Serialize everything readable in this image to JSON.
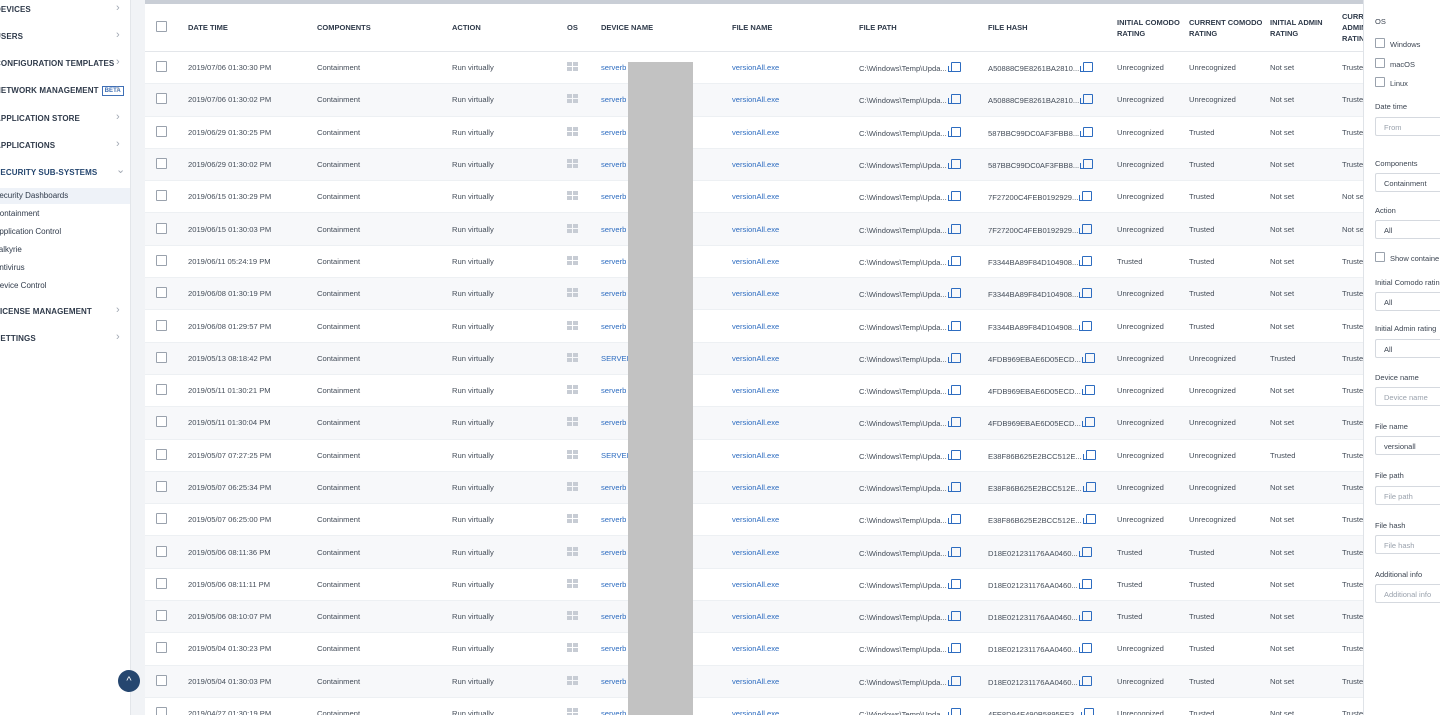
{
  "sidebar": {
    "items": [
      {
        "label": "DEVICES",
        "chevron": "›"
      },
      {
        "label": "USERS",
        "chevron": "›"
      },
      {
        "label": "CONFIGURATION TEMPLATES",
        "chevron": "›"
      },
      {
        "label": "NETWORK MANAGEMENT",
        "badge": "BETA",
        "chevron": "›"
      },
      {
        "label": "APPLICATION STORE",
        "chevron": "›"
      },
      {
        "label": "APPLICATIONS",
        "chevron": "›"
      },
      {
        "label": "SECURITY SUB-SYSTEMS",
        "chevron": "⌄"
      }
    ],
    "subitems": [
      "Security Dashboards",
      "Containment",
      "Application Control",
      "Valkyrie",
      "Antivirus",
      "Device Control"
    ],
    "bottom_items": [
      {
        "label": "LICENSE MANAGEMENT",
        "chevron": "›"
      },
      {
        "label": "SETTINGS",
        "chevron": "›"
      }
    ],
    "scroll_top_icon": "^"
  },
  "table": {
    "columns": [
      "DATE TIME",
      "COMPONENTS",
      "ACTION",
      "OS",
      "DEVICE NAME",
      "FILE NAME",
      "FILE PATH",
      "FILE HASH",
      "INITIAL COMODO RATING",
      "CURRENT COMODO RATING",
      "INITIAL ADMIN RATING",
      "CURRENT ADMIN RATING"
    ],
    "rows": [
      {
        "date": "2019/07/06 01:30:30 PM",
        "component": "Containment",
        "action": "Run virtually",
        "device": "serverb",
        "file": "versionAll.exe",
        "path": "C:\\Windows\\Temp\\Upda...",
        "hash": "A50888C9E8261BA2810...",
        "icr": "Unrecognized",
        "ccr": "Unrecognized",
        "iar": "Not set",
        "car": "Truste"
      },
      {
        "date": "2019/07/06 01:30:02 PM",
        "component": "Containment",
        "action": "Run virtually",
        "device": "serverb",
        "file": "versionAll.exe",
        "path": "C:\\Windows\\Temp\\Upda...",
        "hash": "A50888C9E8261BA2810...",
        "icr": "Unrecognized",
        "ccr": "Unrecognized",
        "iar": "Not set",
        "car": "Truste"
      },
      {
        "date": "2019/06/29 01:30:25 PM",
        "component": "Containment",
        "action": "Run virtually",
        "device": "serverb",
        "file": "versionAll.exe",
        "path": "C:\\Windows\\Temp\\Upda...",
        "hash": "587BBC99DC0AF3FBB8...",
        "icr": "Unrecognized",
        "ccr": "Trusted",
        "iar": "Not set",
        "car": "Truste"
      },
      {
        "date": "2019/06/29 01:30:02 PM",
        "component": "Containment",
        "action": "Run virtually",
        "device": "serverb",
        "file": "versionAll.exe",
        "path": "C:\\Windows\\Temp\\Upda...",
        "hash": "587BBC99DC0AF3FBB8...",
        "icr": "Unrecognized",
        "ccr": "Trusted",
        "iar": "Not set",
        "car": "Truste"
      },
      {
        "date": "2019/06/15 01:30:29 PM",
        "component": "Containment",
        "action": "Run virtually",
        "device": "serverb",
        "file": "versionAll.exe",
        "path": "C:\\Windows\\Temp\\Upda...",
        "hash": "7F27200C4FEB0192929...",
        "icr": "Unrecognized",
        "ccr": "Trusted",
        "iar": "Not set",
        "car": "Not se"
      },
      {
        "date": "2019/06/15 01:30:03 PM",
        "component": "Containment",
        "action": "Run virtually",
        "device": "serverb",
        "file": "versionAll.exe",
        "path": "C:\\Windows\\Temp\\Upda...",
        "hash": "7F27200C4FEB0192929...",
        "icr": "Unrecognized",
        "ccr": "Trusted",
        "iar": "Not set",
        "car": "Not se"
      },
      {
        "date": "2019/06/11 05:24:19 PM",
        "component": "Containment",
        "action": "Run virtually",
        "device": "serverb",
        "file": "versionAll.exe",
        "path": "C:\\Windows\\Temp\\Upda...",
        "hash": "F3344BA89F84D104908...",
        "icr": "Trusted",
        "ccr": "Trusted",
        "iar": "Not set",
        "car": "Truste"
      },
      {
        "date": "2019/06/08 01:30:19 PM",
        "component": "Containment",
        "action": "Run virtually",
        "device": "serverb",
        "file": "versionAll.exe",
        "path": "C:\\Windows\\Temp\\Upda...",
        "hash": "F3344BA89F84D104908...",
        "icr": "Unrecognized",
        "ccr": "Trusted",
        "iar": "Not set",
        "car": "Truste"
      },
      {
        "date": "2019/06/08 01:29:57 PM",
        "component": "Containment",
        "action": "Run virtually",
        "device": "serverb",
        "file": "versionAll.exe",
        "path": "C:\\Windows\\Temp\\Upda...",
        "hash": "F3344BA89F84D104908...",
        "icr": "Unrecognized",
        "ccr": "Trusted",
        "iar": "Not set",
        "car": "Truste"
      },
      {
        "date": "2019/05/13 08:18:42 PM",
        "component": "Containment",
        "action": "Run virtually",
        "device": "SERVEI",
        "file": "versionAll.exe",
        "path": "C:\\Windows\\Temp\\Upda...",
        "hash": "4FDB969EBAE6D05ECD...",
        "icr": "Unrecognized",
        "ccr": "Unrecognized",
        "iar": "Trusted",
        "car": "Truste"
      },
      {
        "date": "2019/05/11 01:30:21 PM",
        "component": "Containment",
        "action": "Run virtually",
        "device": "serverb",
        "file": "versionAll.exe",
        "path": "C:\\Windows\\Temp\\Upda...",
        "hash": "4FDB969EBAE6D05ECD...",
        "icr": "Unrecognized",
        "ccr": "Unrecognized",
        "iar": "Not set",
        "car": "Truste"
      },
      {
        "date": "2019/05/11 01:30:04 PM",
        "component": "Containment",
        "action": "Run virtually",
        "device": "serverb",
        "file": "versionAll.exe",
        "path": "C:\\Windows\\Temp\\Upda...",
        "hash": "4FDB969EBAE6D05ECD...",
        "icr": "Unrecognized",
        "ccr": "Unrecognized",
        "iar": "Not set",
        "car": "Truste"
      },
      {
        "date": "2019/05/07 07:27:25 PM",
        "component": "Containment",
        "action": "Run virtually",
        "device": "SERVEI",
        "file": "versionAll.exe",
        "path": "C:\\Windows\\Temp\\Upda...",
        "hash": "E38F86B625E2BCC512E...",
        "icr": "Unrecognized",
        "ccr": "Unrecognized",
        "iar": "Trusted",
        "car": "Truste"
      },
      {
        "date": "2019/05/07 06:25:34 PM",
        "component": "Containment",
        "action": "Run virtually",
        "device": "serverb",
        "file": "versionAll.exe",
        "path": "C:\\Windows\\Temp\\Upda...",
        "hash": "E38F86B625E2BCC512E...",
        "icr": "Unrecognized",
        "ccr": "Unrecognized",
        "iar": "Not set",
        "car": "Truste"
      },
      {
        "date": "2019/05/07 06:25:00 PM",
        "component": "Containment",
        "action": "Run virtually",
        "device": "serverb",
        "file": "versionAll.exe",
        "path": "C:\\Windows\\Temp\\Upda...",
        "hash": "E38F86B625E2BCC512E...",
        "icr": "Unrecognized",
        "ccr": "Unrecognized",
        "iar": "Not set",
        "car": "Truste"
      },
      {
        "date": "2019/05/06 08:11:36 PM",
        "component": "Containment",
        "action": "Run virtually",
        "device": "serverb",
        "file": "versionAll.exe",
        "path": "C:\\Windows\\Temp\\Upda...",
        "hash": "D18E021231176AA0460...",
        "icr": "Trusted",
        "ccr": "Trusted",
        "iar": "Not set",
        "car": "Truste"
      },
      {
        "date": "2019/05/06 08:11:11 PM",
        "component": "Containment",
        "action": "Run virtually",
        "device": "serverb",
        "file": "versionAll.exe",
        "path": "C:\\Windows\\Temp\\Upda...",
        "hash": "D18E021231176AA0460...",
        "icr": "Trusted",
        "ccr": "Trusted",
        "iar": "Not set",
        "car": "Truste"
      },
      {
        "date": "2019/05/06 08:10:07 PM",
        "component": "Containment",
        "action": "Run virtually",
        "device": "serverb",
        "file": "versionAll.exe",
        "path": "C:\\Windows\\Temp\\Upda...",
        "hash": "D18E021231176AA0460...",
        "icr": "Trusted",
        "ccr": "Trusted",
        "iar": "Not set",
        "car": "Truste"
      },
      {
        "date": "2019/05/04 01:30:23 PM",
        "component": "Containment",
        "action": "Run virtually",
        "device": "serverb",
        "file": "versionAll.exe",
        "path": "C:\\Windows\\Temp\\Upda...",
        "hash": "D18E021231176AA0460...",
        "icr": "Unrecognized",
        "ccr": "Trusted",
        "iar": "Not set",
        "car": "Truste"
      },
      {
        "date": "2019/05/04 01:30:03 PM",
        "component": "Containment",
        "action": "Run virtually",
        "device": "serverb",
        "file": "versionAll.exe",
        "path": "C:\\Windows\\Temp\\Upda...",
        "hash": "D18E021231176AA0460...",
        "icr": "Unrecognized",
        "ccr": "Trusted",
        "iar": "Not set",
        "car": "Truste"
      },
      {
        "date": "2019/04/27 01:30:19 PM",
        "component": "Containment",
        "action": "Run virtually",
        "device": "serverb",
        "file": "versionAll.exe",
        "path": "C:\\Windows\\Temp\\Upda...",
        "hash": "4FE8D94E490B5895EE3...",
        "icr": "Unrecognized",
        "ccr": "Trusted",
        "iar": "Not set",
        "car": "Truste"
      }
    ]
  },
  "filters": {
    "os_label": "OS",
    "os_options": [
      "Windows",
      "macOS",
      "Linux"
    ],
    "datetime_label": "Date time",
    "datetime_from_placeholder": "From",
    "components_label": "Components",
    "components_value": "Containment",
    "action_label": "Action",
    "action_value": "All",
    "show_contained_label": "Show containe",
    "initial_comodo_label": "Initial Comodo ratin",
    "initial_comodo_value": "All",
    "initial_admin_label": "Initial Admin rating",
    "initial_admin_value": "All",
    "device_name_label": "Device name",
    "device_name_placeholder": "Device name",
    "file_name_label": "File name",
    "file_name_value": "versionall",
    "file_path_label": "File path",
    "file_path_placeholder": "File path",
    "file_hash_label": "File hash",
    "file_hash_placeholder": "File hash",
    "additional_info_label": "Additional info",
    "additional_info_placeholder": "Additional info"
  },
  "colors": {
    "link": "#2d6cc0",
    "nav_dark": "#25466f"
  }
}
